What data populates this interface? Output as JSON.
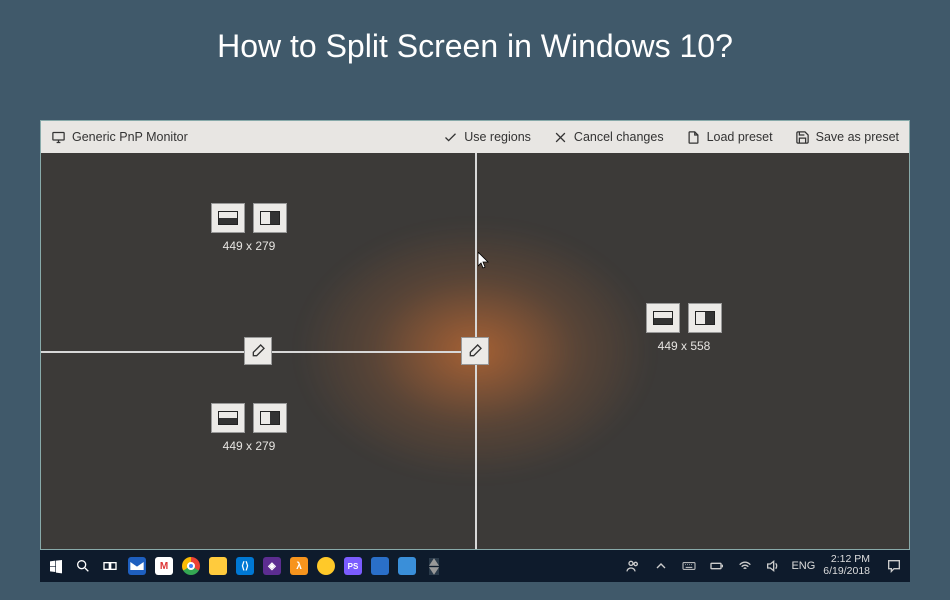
{
  "page_title": "How to Split Screen in Windows 10?",
  "toolbar": {
    "monitor_label": "Generic PnP Monitor",
    "use_regions": "Use regions",
    "cancel_changes": "Cancel changes",
    "load_preset": "Load preset",
    "save_preset": "Save as preset"
  },
  "regions": {
    "top_left": "449 x 279",
    "bottom_left": "449 x 279",
    "right": "449 x 558"
  },
  "taskbar": {
    "language": "ENG",
    "time": "2:12 PM",
    "date": "6/19/2018"
  }
}
